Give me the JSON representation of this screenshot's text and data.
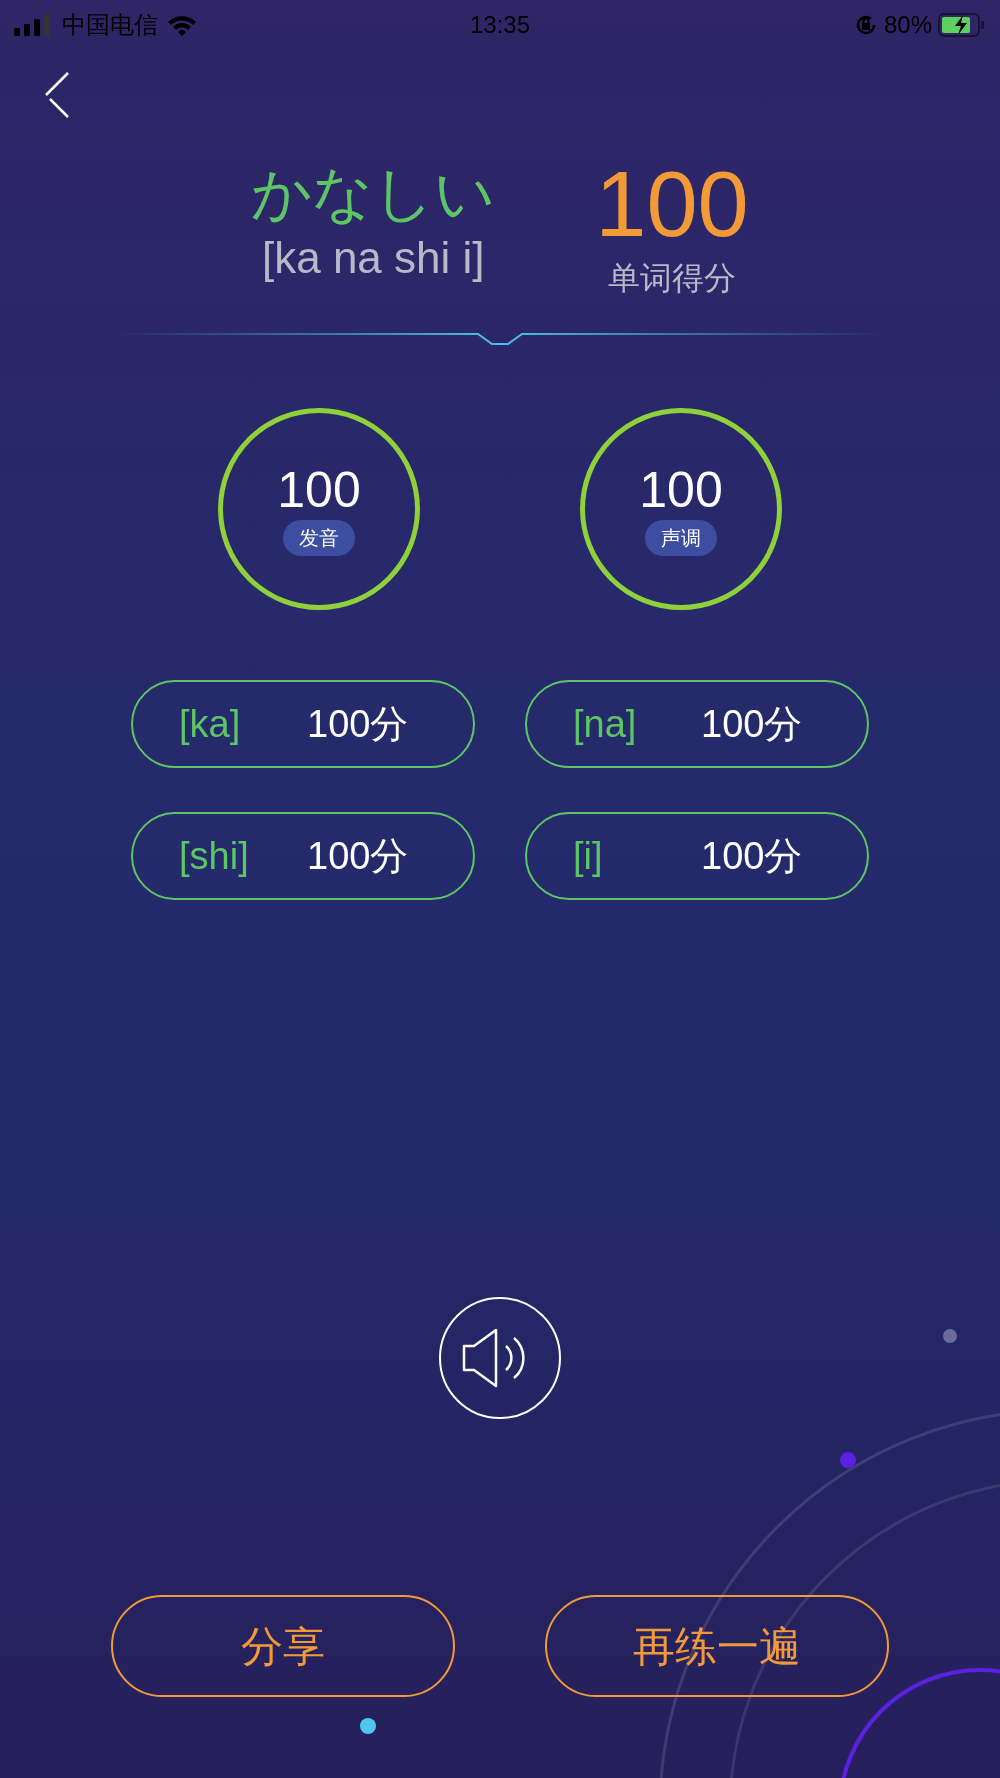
{
  "status_bar": {
    "carrier": "中国电信",
    "time": "13:35",
    "battery": "80%"
  },
  "word": {
    "kana": "かなしい",
    "romaji": "[ka na shi i]",
    "score": "100",
    "score_label": "单词得分"
  },
  "scores": [
    {
      "value": "100",
      "label": "发音"
    },
    {
      "value": "100",
      "label": "声调"
    }
  ],
  "syllables": [
    {
      "syllable": "[ka]",
      "score": "100分"
    },
    {
      "syllable": "[na]",
      "score": "100分"
    },
    {
      "syllable": "[shi]",
      "score": "100分"
    },
    {
      "syllable": "[i]",
      "score": "100分"
    }
  ],
  "buttons": [
    "分享",
    "再练一遍"
  ]
}
